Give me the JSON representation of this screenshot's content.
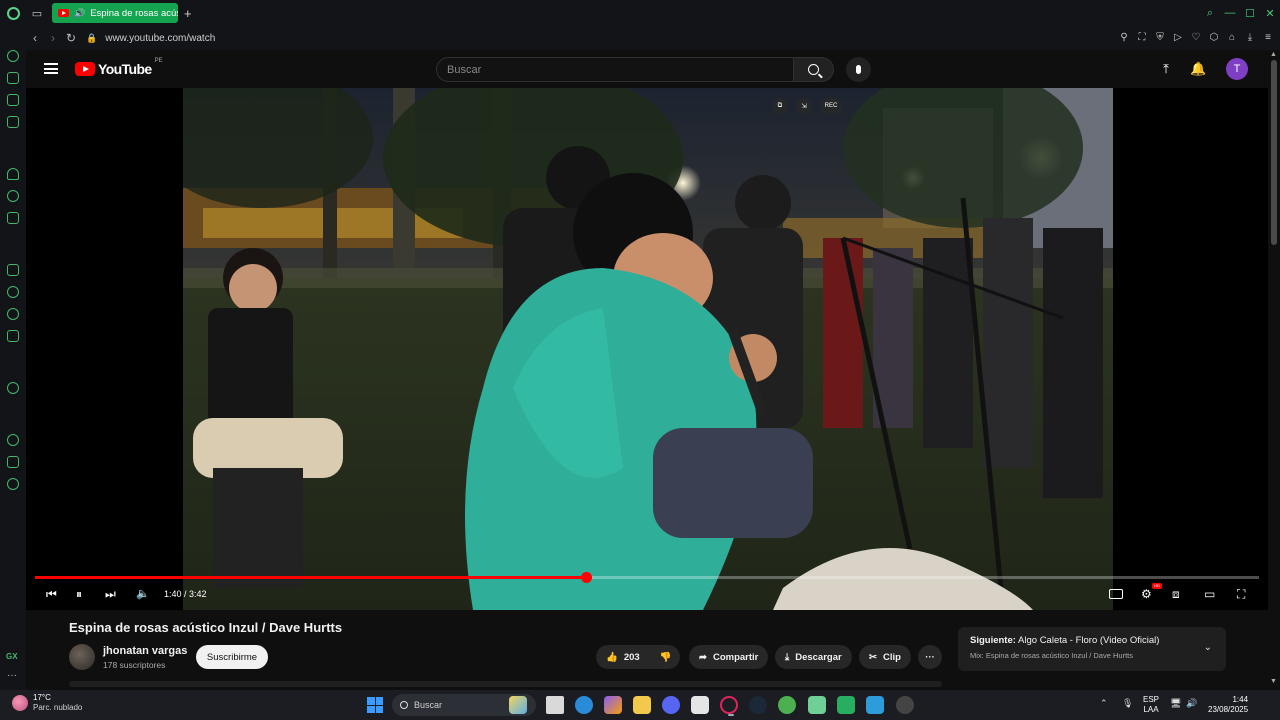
{
  "browser": {
    "tab_title": "Espina de rosas acústi",
    "new_tab": "+",
    "url": "www.youtube.com/watch"
  },
  "youtube": {
    "logo_text": "YouTube",
    "country_code": "PE",
    "search_placeholder": "Buscar",
    "avatar_letter": "T",
    "overlay_rec": "REC"
  },
  "player": {
    "current_time": "1:40",
    "duration": "3:42",
    "time_display": "1:40 / 3:42",
    "progress_fraction": 0.45,
    "hd_badge": "HD"
  },
  "video": {
    "title": "Espina de rosas acústico Inzul / Dave Hurtts",
    "channel": "jhonatan vargas",
    "subscribers": "178 suscriptores",
    "subscribe_label": "Suscribirme",
    "likes": "203",
    "share_label": "Compartir",
    "download_label": "Descargar",
    "clip_label": "Clip",
    "more_label": "···"
  },
  "up_next": {
    "prefix": "Siguiente:",
    "title": "Algo Caleta - Floro (Video Oficial)",
    "mix": "Mix: Espina de rosas acústico Inzul / Dave Hurtts"
  },
  "taskbar": {
    "temperature": "17°C",
    "condition": "Parc. nublado",
    "search_label": "Buscar",
    "lang1": "ESP",
    "lang2": "LAA",
    "time": "1:44",
    "date": "23/08/2025"
  },
  "sidebar_label": "GX",
  "colors": {
    "accent_green": "#14a34f",
    "youtube_red": "#ff0000",
    "progress_red": "#ff0000",
    "avatar_purple": "#7e3fc4"
  }
}
